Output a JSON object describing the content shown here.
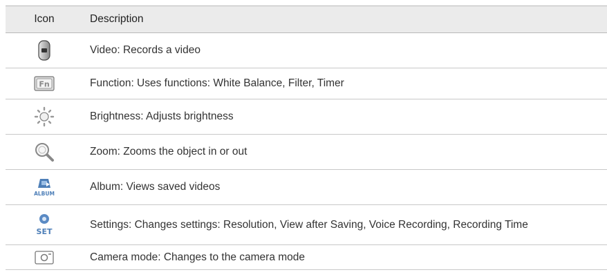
{
  "table": {
    "header": {
      "icon": "Icon",
      "description": "Description"
    },
    "rows": [
      {
        "icon": "video-icon",
        "description": "Video: Records a video"
      },
      {
        "icon": "function-icon",
        "description": "Function: Uses functions: White Balance, Filter, Timer"
      },
      {
        "icon": "brightness-icon",
        "description": "Brightness: Adjusts brightness"
      },
      {
        "icon": "zoom-icon",
        "description": "Zoom: Zooms the object in or out"
      },
      {
        "icon": "album-icon",
        "description": "Album: Views saved videos",
        "icon_text": "ALBUM"
      },
      {
        "icon": "settings-icon",
        "description": "Settings: Changes settings: Resolution, View after Saving, Voice Recording, Recording Time",
        "icon_text": "SET"
      },
      {
        "icon": "camera-mode-icon",
        "description": "Camera mode: Changes to the camera mode"
      }
    ]
  }
}
